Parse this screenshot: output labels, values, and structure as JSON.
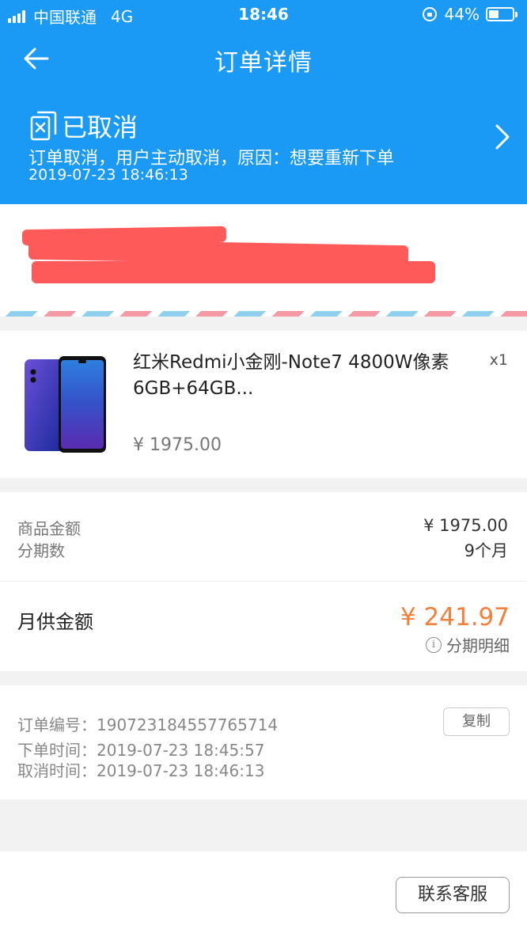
{
  "status_bar": {
    "carrier": "中国联通",
    "network": "4G",
    "time": "18:46",
    "battery": "44%",
    "battery_level": 0.44
  },
  "nav": {
    "title": "订单详情"
  },
  "order_status": {
    "title": "已取消",
    "reason": "订单取消，用户主动取消，原因：想要重新下单",
    "time": "2019-07-23 18:46:13"
  },
  "product": {
    "name": "红米Redmi小金刚-Note7 4800W像素 6GB+64GB...",
    "quantity": "x1",
    "price": "¥ 1975.00"
  },
  "amounts": {
    "goods_label": "商品金额",
    "goods_value": "¥ 1975.00",
    "installments_label": "分期数",
    "installments_value": "9个月",
    "monthly_label": "月供金额",
    "monthly_value": "¥ 241.97",
    "plan_link": "分期明细"
  },
  "order_info": {
    "number_label": "订单编号：",
    "number_value": "190723184557765714",
    "copy_label": "复制",
    "placed_label": "下单时间：",
    "placed_value": "2019-07-23 18:45:57",
    "cancelled_label": "取消时间：",
    "cancelled_value": "2019-07-23 18:46:13"
  },
  "footer": {
    "contact_label": "联系客服"
  },
  "colors": {
    "header_blue": "#1a9af5",
    "accent_orange": "#f5803c",
    "redaction": "#ff5a5a"
  }
}
